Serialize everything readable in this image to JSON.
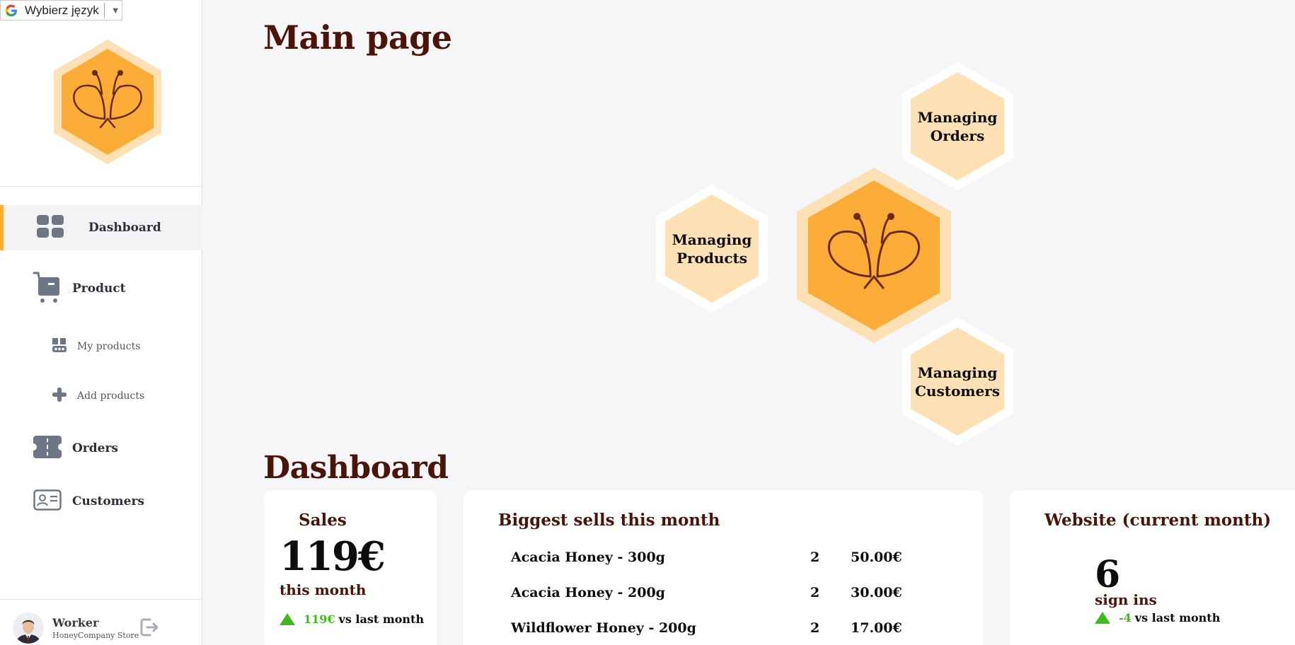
{
  "language_selector": {
    "label": "Wybierz język"
  },
  "sidebar": {
    "items": [
      {
        "label": "Dashboard",
        "icon": "dashboard-grid-icon",
        "active": true
      },
      {
        "label": "Product",
        "icon": "cart-icon"
      },
      {
        "label": "My products",
        "icon": "product-box-icon"
      },
      {
        "label": "Add products",
        "icon": "plus-icon"
      },
      {
        "label": "Orders",
        "icon": "ticket-icon"
      },
      {
        "label": "Customers",
        "icon": "id-card-icon"
      }
    ],
    "user": {
      "name": "Worker",
      "store": "HoneyCompany Store"
    }
  },
  "main": {
    "title": "Main page",
    "hex_links": [
      {
        "line1": "Managing",
        "line2": "Orders"
      },
      {
        "line1": "Managing",
        "line2": "Products"
      },
      {
        "line1": "Managing",
        "line2": "Customers"
      }
    ],
    "dashboard_title": "Dashboard"
  },
  "dashboard": {
    "sales": {
      "title": "Sales",
      "value": "119€",
      "period": "this month",
      "delta": "119€",
      "delta_text": "vs last month"
    },
    "biggest_sells": {
      "title": "Biggest sells this month",
      "rows": [
        {
          "name": "Acacia Honey - 300g",
          "qty": "2",
          "price": "50.00€"
        },
        {
          "name": "Acacia Honey - 200g",
          "qty": "2",
          "price": "30.00€"
        },
        {
          "name": "Wildflower Honey - 200g",
          "qty": "2",
          "price": "17.00€"
        }
      ]
    },
    "website": {
      "title": "Website (current month)",
      "value": "6",
      "label": "sign ins",
      "delta": "-4",
      "delta_text": "vs last month"
    }
  },
  "colors": {
    "honey": "#fbac36",
    "honey_light": "#fde0b3",
    "heading": "#4a1408",
    "positive": "#3fba1d"
  }
}
